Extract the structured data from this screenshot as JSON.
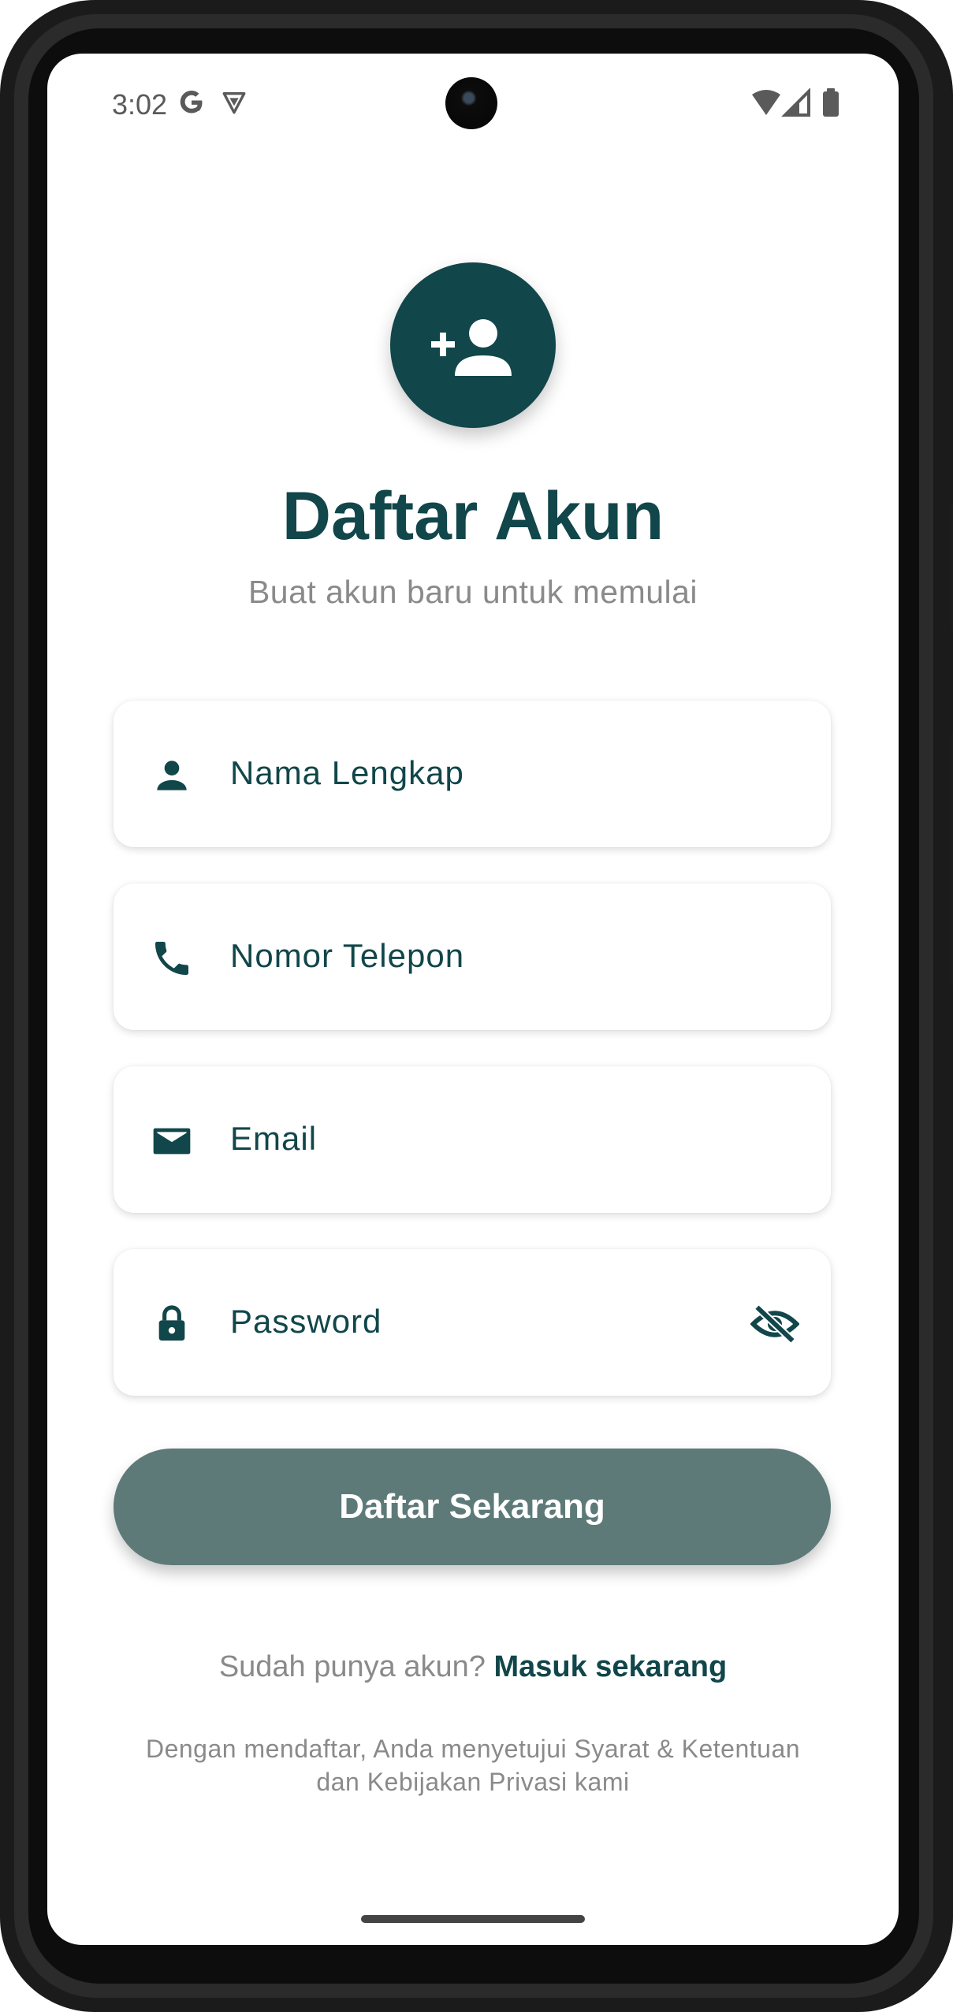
{
  "status_bar": {
    "time": "3:02",
    "icons": [
      "google-g-icon",
      "shield-vpn-icon",
      "wifi-icon",
      "cellular-signal-icon",
      "battery-icon"
    ]
  },
  "header": {
    "icon": "person-add-icon",
    "title": "Daftar Akun",
    "subtitle": "Buat akun baru untuk memulai"
  },
  "form": {
    "fields": [
      {
        "label": "Nama Lengkap",
        "icon": "person-icon"
      },
      {
        "label": "Nomor Telepon",
        "icon": "phone-icon"
      },
      {
        "label": "Email",
        "icon": "email-icon"
      },
      {
        "label": "Password",
        "icon": "lock-icon",
        "trailing_icon": "visibility-off-icon"
      }
    ],
    "submit_label": "Daftar Sekarang"
  },
  "footer": {
    "login_prompt": "Sudah punya akun?",
    "login_link": "Masuk sekarang",
    "terms_line1": "Dengan mendaftar, Anda menyetujui Syarat & Ketentuan",
    "terms_line2": "dan Kebijakan Privasi kami"
  },
  "colors": {
    "primary": "#11464a",
    "button": "#5d7a79",
    "muted_text": "#8a8a8a"
  }
}
